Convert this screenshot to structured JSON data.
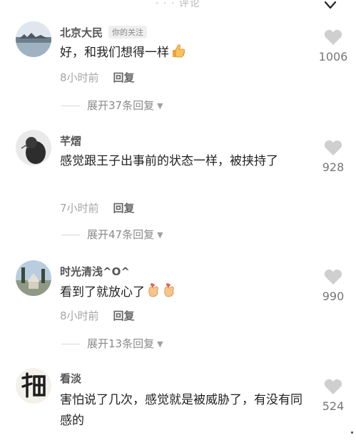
{
  "header": {
    "title": "· · · 评论"
  },
  "comments": [
    {
      "username": "北京大民",
      "tag": "你的关注",
      "text": "好，和我们想得一样",
      "time": "8小时前",
      "reply_label": "回复",
      "expand_label": "展开37条回复",
      "likes": "1006",
      "emoji": "thumbs-up"
    },
    {
      "username": "芊熠",
      "text": "感觉跟王子出事前的状态一样，被挟持了",
      "time": "7小时前",
      "reply_label": "回复",
      "expand_label": "展开47条回复",
      "likes": "928"
    },
    {
      "username": "时光清浅^O^",
      "text": "看到了就放心了",
      "time": "8小时前",
      "reply_label": "回复",
      "expand_label": "展开13条回复",
      "likes": "990",
      "emoji": "finger-heart x2"
    },
    {
      "username": "看淡",
      "text": "害怕说了几次，感觉就是被威胁了，有没有同感的",
      "likes": "524"
    }
  ],
  "colors": {
    "heart": "#cfcfcf",
    "username": "#555555",
    "meta": "#a5a5a5",
    "text": "#222222"
  }
}
